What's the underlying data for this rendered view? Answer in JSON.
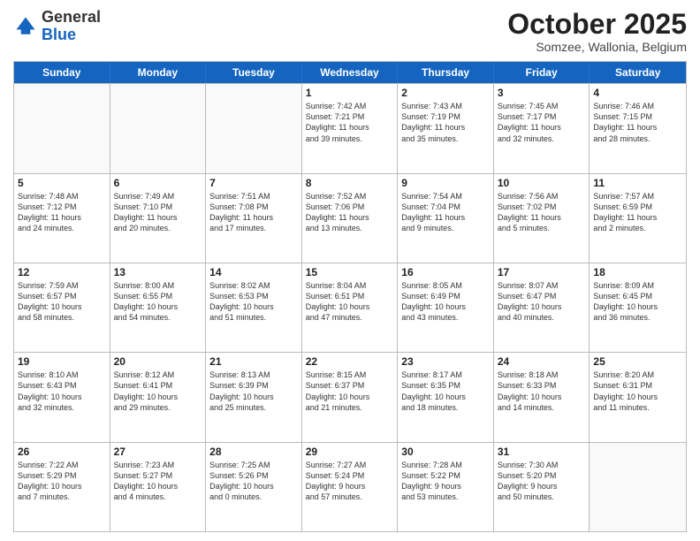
{
  "header": {
    "logo": {
      "line1": "General",
      "line2": "Blue"
    },
    "month": "October 2025",
    "location": "Somzee, Wallonia, Belgium"
  },
  "days": [
    "Sunday",
    "Monday",
    "Tuesday",
    "Wednesday",
    "Thursday",
    "Friday",
    "Saturday"
  ],
  "weeks": [
    [
      {
        "day": "",
        "info": ""
      },
      {
        "day": "",
        "info": ""
      },
      {
        "day": "",
        "info": ""
      },
      {
        "day": "1",
        "info": "Sunrise: 7:42 AM\nSunset: 7:21 PM\nDaylight: 11 hours\nand 39 minutes."
      },
      {
        "day": "2",
        "info": "Sunrise: 7:43 AM\nSunset: 7:19 PM\nDaylight: 11 hours\nand 35 minutes."
      },
      {
        "day": "3",
        "info": "Sunrise: 7:45 AM\nSunset: 7:17 PM\nDaylight: 11 hours\nand 32 minutes."
      },
      {
        "day": "4",
        "info": "Sunrise: 7:46 AM\nSunset: 7:15 PM\nDaylight: 11 hours\nand 28 minutes."
      }
    ],
    [
      {
        "day": "5",
        "info": "Sunrise: 7:48 AM\nSunset: 7:12 PM\nDaylight: 11 hours\nand 24 minutes."
      },
      {
        "day": "6",
        "info": "Sunrise: 7:49 AM\nSunset: 7:10 PM\nDaylight: 11 hours\nand 20 minutes."
      },
      {
        "day": "7",
        "info": "Sunrise: 7:51 AM\nSunset: 7:08 PM\nDaylight: 11 hours\nand 17 minutes."
      },
      {
        "day": "8",
        "info": "Sunrise: 7:52 AM\nSunset: 7:06 PM\nDaylight: 11 hours\nand 13 minutes."
      },
      {
        "day": "9",
        "info": "Sunrise: 7:54 AM\nSunset: 7:04 PM\nDaylight: 11 hours\nand 9 minutes."
      },
      {
        "day": "10",
        "info": "Sunrise: 7:56 AM\nSunset: 7:02 PM\nDaylight: 11 hours\nand 5 minutes."
      },
      {
        "day": "11",
        "info": "Sunrise: 7:57 AM\nSunset: 6:59 PM\nDaylight: 11 hours\nand 2 minutes."
      }
    ],
    [
      {
        "day": "12",
        "info": "Sunrise: 7:59 AM\nSunset: 6:57 PM\nDaylight: 10 hours\nand 58 minutes."
      },
      {
        "day": "13",
        "info": "Sunrise: 8:00 AM\nSunset: 6:55 PM\nDaylight: 10 hours\nand 54 minutes."
      },
      {
        "day": "14",
        "info": "Sunrise: 8:02 AM\nSunset: 6:53 PM\nDaylight: 10 hours\nand 51 minutes."
      },
      {
        "day": "15",
        "info": "Sunrise: 8:04 AM\nSunset: 6:51 PM\nDaylight: 10 hours\nand 47 minutes."
      },
      {
        "day": "16",
        "info": "Sunrise: 8:05 AM\nSunset: 6:49 PM\nDaylight: 10 hours\nand 43 minutes."
      },
      {
        "day": "17",
        "info": "Sunrise: 8:07 AM\nSunset: 6:47 PM\nDaylight: 10 hours\nand 40 minutes."
      },
      {
        "day": "18",
        "info": "Sunrise: 8:09 AM\nSunset: 6:45 PM\nDaylight: 10 hours\nand 36 minutes."
      }
    ],
    [
      {
        "day": "19",
        "info": "Sunrise: 8:10 AM\nSunset: 6:43 PM\nDaylight: 10 hours\nand 32 minutes."
      },
      {
        "day": "20",
        "info": "Sunrise: 8:12 AM\nSunset: 6:41 PM\nDaylight: 10 hours\nand 29 minutes."
      },
      {
        "day": "21",
        "info": "Sunrise: 8:13 AM\nSunset: 6:39 PM\nDaylight: 10 hours\nand 25 minutes."
      },
      {
        "day": "22",
        "info": "Sunrise: 8:15 AM\nSunset: 6:37 PM\nDaylight: 10 hours\nand 21 minutes."
      },
      {
        "day": "23",
        "info": "Sunrise: 8:17 AM\nSunset: 6:35 PM\nDaylight: 10 hours\nand 18 minutes."
      },
      {
        "day": "24",
        "info": "Sunrise: 8:18 AM\nSunset: 6:33 PM\nDaylight: 10 hours\nand 14 minutes."
      },
      {
        "day": "25",
        "info": "Sunrise: 8:20 AM\nSunset: 6:31 PM\nDaylight: 10 hours\nand 11 minutes."
      }
    ],
    [
      {
        "day": "26",
        "info": "Sunrise: 7:22 AM\nSunset: 5:29 PM\nDaylight: 10 hours\nand 7 minutes."
      },
      {
        "day": "27",
        "info": "Sunrise: 7:23 AM\nSunset: 5:27 PM\nDaylight: 10 hours\nand 4 minutes."
      },
      {
        "day": "28",
        "info": "Sunrise: 7:25 AM\nSunset: 5:26 PM\nDaylight: 10 hours\nand 0 minutes."
      },
      {
        "day": "29",
        "info": "Sunrise: 7:27 AM\nSunset: 5:24 PM\nDaylight: 9 hours\nand 57 minutes."
      },
      {
        "day": "30",
        "info": "Sunrise: 7:28 AM\nSunset: 5:22 PM\nDaylight: 9 hours\nand 53 minutes."
      },
      {
        "day": "31",
        "info": "Sunrise: 7:30 AM\nSunset: 5:20 PM\nDaylight: 9 hours\nand 50 minutes."
      },
      {
        "day": "",
        "info": ""
      }
    ]
  ]
}
